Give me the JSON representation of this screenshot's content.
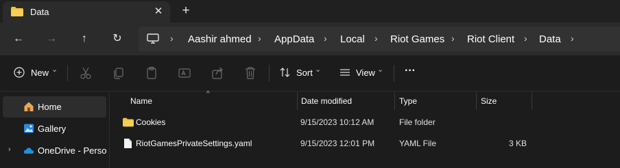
{
  "tab": {
    "title": "Data",
    "close_glyph": "✕",
    "new_glyph": "+"
  },
  "nav": {
    "back": "←",
    "forward": "→",
    "up": "↑",
    "refresh": "↻"
  },
  "breadcrumb": {
    "items": [
      "Aashir ahmed",
      "AppData",
      "Local",
      "Riot Games",
      "Riot Client",
      "Data"
    ],
    "separator": "›"
  },
  "commands": {
    "new_label": "New",
    "sort_label": "Sort",
    "view_label": "View",
    "more": "···",
    "chevron": "⌄"
  },
  "sidebar": {
    "items": [
      {
        "label": "Home"
      },
      {
        "label": "Gallery"
      },
      {
        "label": "OneDrive - Persona"
      }
    ],
    "expander": "›"
  },
  "columns": {
    "name": "Name",
    "date": "Date modified",
    "type": "Type",
    "size": "Size",
    "sort_indicator": "^"
  },
  "files": [
    {
      "name": "Cookies",
      "date": "9/15/2023 10:12 AM",
      "type": "File folder",
      "size": ""
    },
    {
      "name": "RiotGamesPrivateSettings.yaml",
      "date": "9/15/2023 12:01 PM",
      "type": "YAML File",
      "size": "3 KB"
    }
  ],
  "colors": {
    "folder": "#f3c13a",
    "accent": "#4cc2ff",
    "background": "#1c1c1c"
  },
  "icons": {
    "tab": "folder-icon",
    "address": "computer-icon",
    "home": "home-icon",
    "gallery": "gallery-icon",
    "onedrive": "cloud-icon"
  }
}
